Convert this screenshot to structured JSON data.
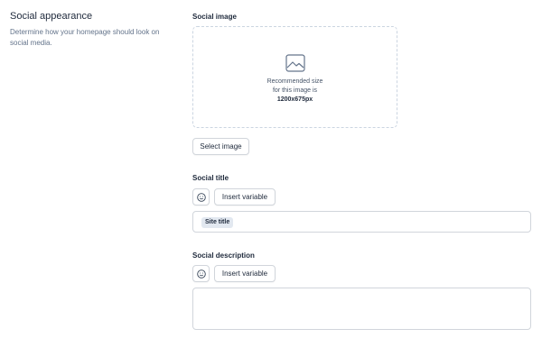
{
  "section": {
    "title": "Social appearance",
    "description": "Determine how your homepage should look on social media."
  },
  "social_image": {
    "label": "Social image",
    "dropzone_line1": "Recommended size",
    "dropzone_line2": "for this image is",
    "dropzone_size": "1200x675px",
    "icon": "image-icon",
    "select_button": "Select image"
  },
  "social_title": {
    "label": "Social title",
    "emoji_icon": "smiley-icon",
    "insert_variable": "Insert variable",
    "chip": "Site title"
  },
  "social_description": {
    "label": "Social description",
    "emoji_icon": "smiley-icon",
    "insert_variable": "Insert variable",
    "value": ""
  }
}
